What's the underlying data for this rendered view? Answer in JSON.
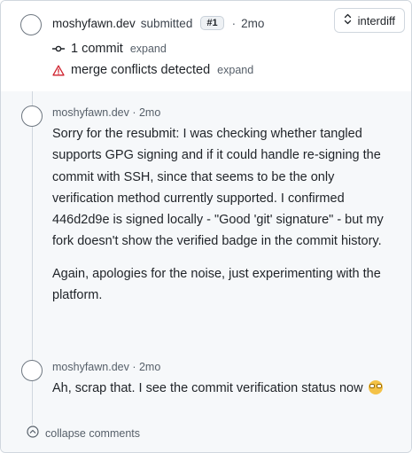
{
  "header": {
    "author": "moshyfawn.dev",
    "action": "submitted",
    "round": "#1",
    "separator": "·",
    "time": "2mo",
    "interdiff_label": "interdiff"
  },
  "commits": {
    "label": "1 commit",
    "expand": "expand"
  },
  "conflicts": {
    "label": "merge conflicts detected",
    "expand": "expand"
  },
  "comments": [
    {
      "meta": "moshyfawn.dev · 2mo",
      "paragraphs": [
        "Sorry for the resubmit: I was checking whether tangled supports GPG signing and if it could handle re-signing the commit with SSH, since that seems to be the only verification method currently supported. I confirmed 446d2d9e is signed locally - \"Good 'git' signature\" - but my fork doesn't show the verified badge in the commit history.",
        "Again, apologies for the noise, just experimenting with the platform."
      ]
    },
    {
      "meta": "moshyfawn.dev · 2mo",
      "paragraphs": [
        "Ah, scrap that. I see the commit verification status now"
      ],
      "emoji": "face-with-open-mouth-emoji"
    }
  ],
  "collapse_label": "collapse comments",
  "colors": {
    "border": "#d0d7de",
    "muted": "#57606a",
    "warning": "#cf222e",
    "panel": "#f6f8fa"
  }
}
